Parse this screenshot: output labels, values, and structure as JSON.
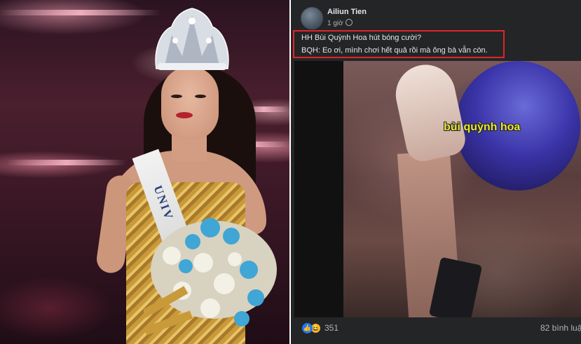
{
  "post": {
    "author": "Ailiun Tien",
    "time": "1 giờ",
    "caption": {
      "line1": "HH Bùi Quỳnh Hoa hút bóng cười?",
      "line2": "BQH: Eo ơi, mình chơi hết quả rồi mà ông bà vẫn còn."
    },
    "video_label": "bùi quỳnh hoa",
    "reactions": "351",
    "comments": "82 bình luậ",
    "icons": {
      "globe": "globe-icon",
      "like": "like-icon",
      "haha": "haha-icon"
    }
  },
  "photo": {
    "sash_text": "UNIV"
  },
  "colors": {
    "fb_dark": "#242526",
    "highlight_border": "#e0242b",
    "video_label": "#e8e83a",
    "like_blue": "#2078f4"
  }
}
